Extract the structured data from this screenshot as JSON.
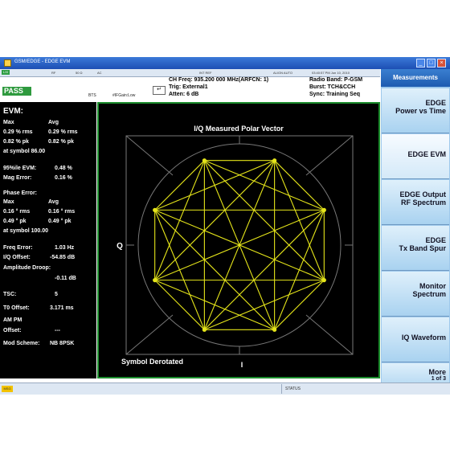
{
  "window": {
    "title": "GSM/EDGE - EDGE EVM"
  },
  "status_strip": {
    "lxi": "LXI",
    "rf": "RF",
    "ohms": "50 Ω",
    "ac": "AC",
    "int_ref": "INT REF",
    "align": "ALIGN AUTO",
    "timestamp": "03:40:57 PM Jun 10, 2010"
  },
  "result": {
    "pass": "PASS",
    "mode": "BTS",
    "gain": "#IFGain:Low"
  },
  "settings": {
    "ch_freq": "CH Freq: 935.200 000 MHz(ARFCN: 1)",
    "trig": "Trig: External1",
    "atten": "Atten: 6 dB",
    "radio_band": "Radio Band: P-GSM",
    "burst": "Burst: TCH&CCH",
    "sync": "Sync: Training Seq"
  },
  "metrics": {
    "title": "EVM:",
    "hdr_max": "Max",
    "hdr_avg": "Avg",
    "evm_rms_max": "0.29 % rms",
    "evm_rms_avg": "0.29 % rms",
    "evm_pk_max": "0.82 % pk",
    "evm_pk_avg": "0.82 % pk",
    "evm_at_symbol": "at symbol 86.00",
    "pct95_label": "95%ile EVM:",
    "pct95_value": "0.48 %",
    "mag_label": "Mag Error:",
    "mag_value": "0.16 %",
    "phase_title": "Phase Error:",
    "ph_hdr_max": "Max",
    "ph_hdr_avg": "Avg",
    "ph_rms_max": "0.16 ° rms",
    "ph_rms_avg": "0.16 ° rms",
    "ph_pk_max": "0.49 ° pk",
    "ph_pk_avg": "0.49 ° pk",
    "ph_at_symbol": "at symbol 100.00",
    "freq_label": "Freq Error:",
    "freq_value": "1.03 Hz",
    "iq_label": "I/Q Offset:",
    "iq_value": "-54.85 dB",
    "amp_label": "Amplitude Droop:",
    "amp_value": "-0.11 dB",
    "tsc_label": "TSC:",
    "tsc_value": "5",
    "t0_label": "T0 Offset:",
    "t0_value": "3.171 ms",
    "ampm_label": "AM PM",
    "offset_label": "Offset:",
    "offset_value": "---",
    "mod_label": "Mod Scheme:",
    "mod_value": "NB 8PSK"
  },
  "plot": {
    "title": "I/Q Measured Polar Vector",
    "q_label": "Q",
    "i_label": "I",
    "footer": "Symbol Derotated",
    "constellation_points": 8,
    "trace_color": "#e6e61a"
  },
  "softkeys": {
    "header": "Measurements",
    "items": [
      {
        "l1": "EDGE",
        "l2": "Power vs Time"
      },
      {
        "l1": "",
        "l2": "EDGE EVM"
      },
      {
        "l1": "EDGE Output",
        "l2": "RF Spectrum"
      },
      {
        "l1": "EDGE",
        "l2": "Tx Band Spur"
      },
      {
        "l1": "Monitor",
        "l2": "Spectrum"
      },
      {
        "l1": "",
        "l2": "IQ Waveform"
      },
      {
        "l1": "More",
        "l2": "1 of 3"
      }
    ]
  },
  "bottom": {
    "msg": "MSG",
    "status": "STATUS"
  }
}
